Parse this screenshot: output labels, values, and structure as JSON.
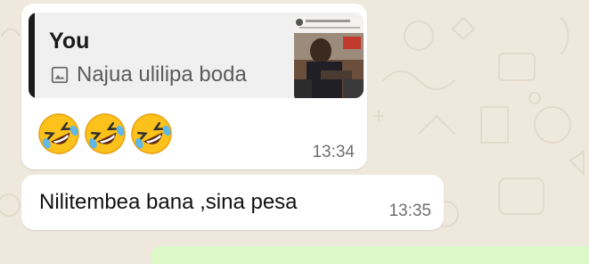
{
  "messages": [
    {
      "quoted": {
        "author": "You",
        "icon": "image-icon",
        "text": "Najua ulilipa boda"
      },
      "emoji": [
        "rolling-on-floor-laughing",
        "rolling-on-floor-laughing",
        "rolling-on-floor-laughing"
      ],
      "time": "13:34"
    },
    {
      "text": "Nilitembea bana ,sina pesa",
      "time": "13:35"
    }
  ],
  "colors": {
    "background": "#efe8dc",
    "bubble": "#ffffff",
    "quote_bg": "#f0f0f0",
    "quote_bar": "#1a1a1a",
    "outgoing_bubble": "#dcf8c6"
  }
}
